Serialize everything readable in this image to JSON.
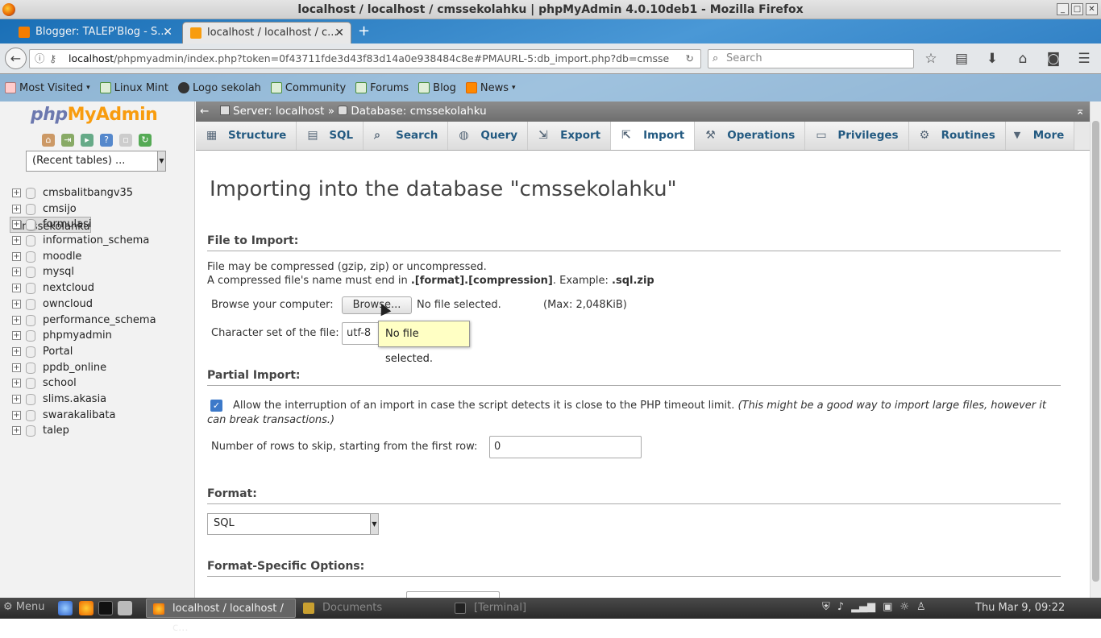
{
  "window": {
    "title": "localhost / localhost / cmssekolahku | phpMyAdmin 4.0.10deb1 - Mozilla Firefox"
  },
  "browser": {
    "tabs": [
      {
        "label": "Blogger: TALEP'Blog - S...",
        "active": false
      },
      {
        "label": "localhost / localhost / c...",
        "active": true
      }
    ],
    "url_host": "localhost",
    "url_rest": "/phpmyadmin/index.php?token=0f43711fde3d43f83d14a0e938484c8e#PMAURL-5:db_import.php?db=cmsse",
    "search_placeholder": "Search",
    "bookmarks": [
      "Most Visited",
      "Linux Mint",
      "Logo sekolah",
      "Community",
      "Forums",
      "Blog",
      "News"
    ]
  },
  "sidebar": {
    "logo_php": "php",
    "logo_my": "MyAdmin",
    "recent_tables": "(Recent tables) ...",
    "databases": [
      "cmsbalitbangv35",
      "cmsijo",
      "cmssekolahku",
      "formulasi",
      "information_schema",
      "moodle",
      "mysql",
      "nextcloud",
      "owncloud",
      "performance_schema",
      "phpmyadmin",
      "Portal",
      "ppdb_online",
      "school",
      "slims.akasia",
      "swarakalibata",
      "talep"
    ],
    "selected": "cmssekolahku"
  },
  "breadcrumb": {
    "server": "Server: localhost",
    "sep": "»",
    "database": "Database: cmssekolahku"
  },
  "tabs": [
    "Structure",
    "SQL",
    "Search",
    "Query",
    "Export",
    "Import",
    "Operations",
    "Privileges",
    "Routines",
    "More"
  ],
  "active_tab": "Import",
  "page": {
    "title": "Importing into the database \"cmssekolahku\"",
    "file_section": "File to Import:",
    "compress_note": "File may be compressed (gzip, zip) or uncompressed.",
    "compress_note2_a": "A compressed file's name must end in ",
    "compress_note2_b": ".[format].[compression]",
    "compress_note2_c": ". Example: ",
    "compress_note2_d": ".sql.zip",
    "browse_label": "Browse your computer:",
    "browse_button": "Browse...",
    "no_file": "No file selected.",
    "max": "(Max: 2,048KiB)",
    "charset_label": "Character set of the file:",
    "charset_value": "utf-8",
    "tooltip": "No file selected.",
    "partial_section": "Partial Import:",
    "allow_interrupt": "Allow the interruption of an import in case the script detects it is close to the PHP timeout limit.",
    "allow_interrupt_note": "(This might be a good way to import large files, however it",
    "allow_interrupt_note2": "can break transactions.)",
    "skip_label": "Number of rows to skip, starting from the first row:",
    "skip_value": "0",
    "format_section": "Format:",
    "format_value": "SQL",
    "format_options_section": "Format-Specific Options:"
  },
  "taskbar": {
    "menu": "Menu",
    "windows": [
      "localhost / localhost / c...",
      "Documents",
      "[Terminal]"
    ],
    "clock": "Thu Mar  9, 09:22"
  }
}
